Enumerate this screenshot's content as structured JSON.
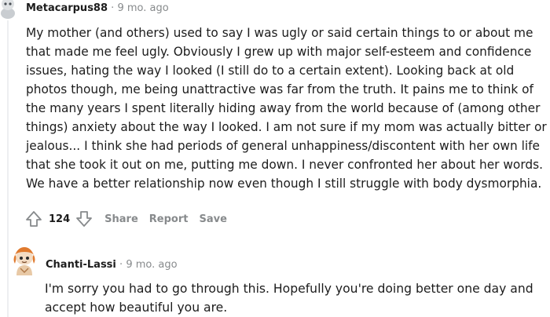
{
  "comments": [
    {
      "author": "Metacarpus88",
      "separator": "·",
      "time": "9 mo. ago",
      "lines": [
        "My mother (and others) used to say I was ugly or said certain things to or about me",
        "that made me feel ugly. Obviously I grew up with major self-esteem and confidence",
        "issues, hating the way I looked (I still do to a certain extent). Looking back at old",
        "photos though, me being unattractive was far from the truth. It pains me to think of",
        "the many years I spent literally hiding away from the world because of (among other",
        "things) anxiety about the way I looked. I am not sure if my mom was actually bitter or",
        "jealous... I think she had periods of general unhappiness/discontent with her own life",
        "that she took it out on me, putting me down. I never confronted her about her words.",
        "We have a better relationship now even though I still struggle with body dysmorphia."
      ],
      "score": "124",
      "actions": {
        "share": "Share",
        "report": "Report",
        "save": "Save"
      }
    },
    {
      "author": "Chanti-Lassi",
      "separator": "·",
      "time": "9 mo. ago",
      "lines": [
        "I'm sorry you had to go through this. Hopefully you're doing better one day and",
        "accept how beautiful you are."
      ]
    }
  ],
  "icons": {
    "avatar_1": "snoo-avatar-icon",
    "avatar_2": "snoo-avatar-icon",
    "upvote": "upvote-arrow-icon",
    "downvote": "downvote-arrow-icon"
  },
  "colors": {
    "meta": "#878a8c",
    "text": "#1c1c1c",
    "accent": "#e07a2e"
  }
}
